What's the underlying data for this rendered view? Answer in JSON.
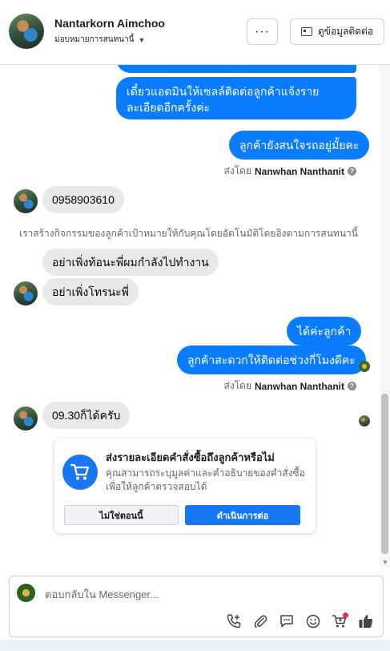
{
  "header": {
    "contact_name": "Nantarkorn Aimchoo",
    "assign_label": "มอบหมายการสนทนานี้",
    "more_label": "···",
    "contact_info_label": "ดูข้อมูลติดต่อ"
  },
  "messages": {
    "out_1": "เดี๋ยวแอดมินให้เซลล์ติดต่อลูกค้าแจ้งรายละเอียดอีกครั้งค่ะ",
    "out_2": "ลูกค้ายังสนใจรถอยู่มั้ยคะ",
    "sent_by_1": {
      "prefix": "ส่งโดย",
      "name": "Nanwhan Nanthanit",
      "help": "?"
    },
    "in_phone": "0958903610",
    "system_note": "เราสร้างกิจกรรมของลูกค้าเป้าหมายให้กับคุณโดยอัตโนมัติโดยอิงตามการสนทนานี้",
    "in_2": "อย่าเพิ่งท้อนะพี่ผมกำลังไปทำงาน",
    "in_3": "อย่าเพิ่งโทรนะพี่",
    "out_3": "ได้ค่ะลูกค้า",
    "out_4": "ลูกค้าสะดวกให้ติดต่อช่วงกี่โมงดีคะ",
    "sent_by_2": {
      "prefix": "ส่งโดย",
      "name": "Nanwhan Nanthanit",
      "help": "?"
    },
    "in_4": "09.30ก็ได้ครับ"
  },
  "order_prompt": {
    "title": "ส่งรายละเอียดคำสั่งซื้อถึงลูกค้าหรือไม่",
    "description": "คุณสามารถระบุมูลค่าและคำอธิบายของคำสั่งซื้อเพื่อให้ลูกค้าตรวจสอบได้",
    "not_now": "ไม่ใช่ตอนนี้",
    "continue": "ดำเนินการต่อ",
    "icon": "cart-icon",
    "accent": "#1877f2"
  },
  "composer": {
    "placeholder": "ตอบกลับใน Messenger...",
    "tools": [
      "call-icon",
      "attach-icon",
      "saved-reply-icon",
      "emoji-icon",
      "cart-icon",
      "like-icon"
    ]
  },
  "colors": {
    "outgoing_bubble": "#0a7cff",
    "incoming_bubble": "#e9e9eb",
    "notification": "#f02849"
  }
}
